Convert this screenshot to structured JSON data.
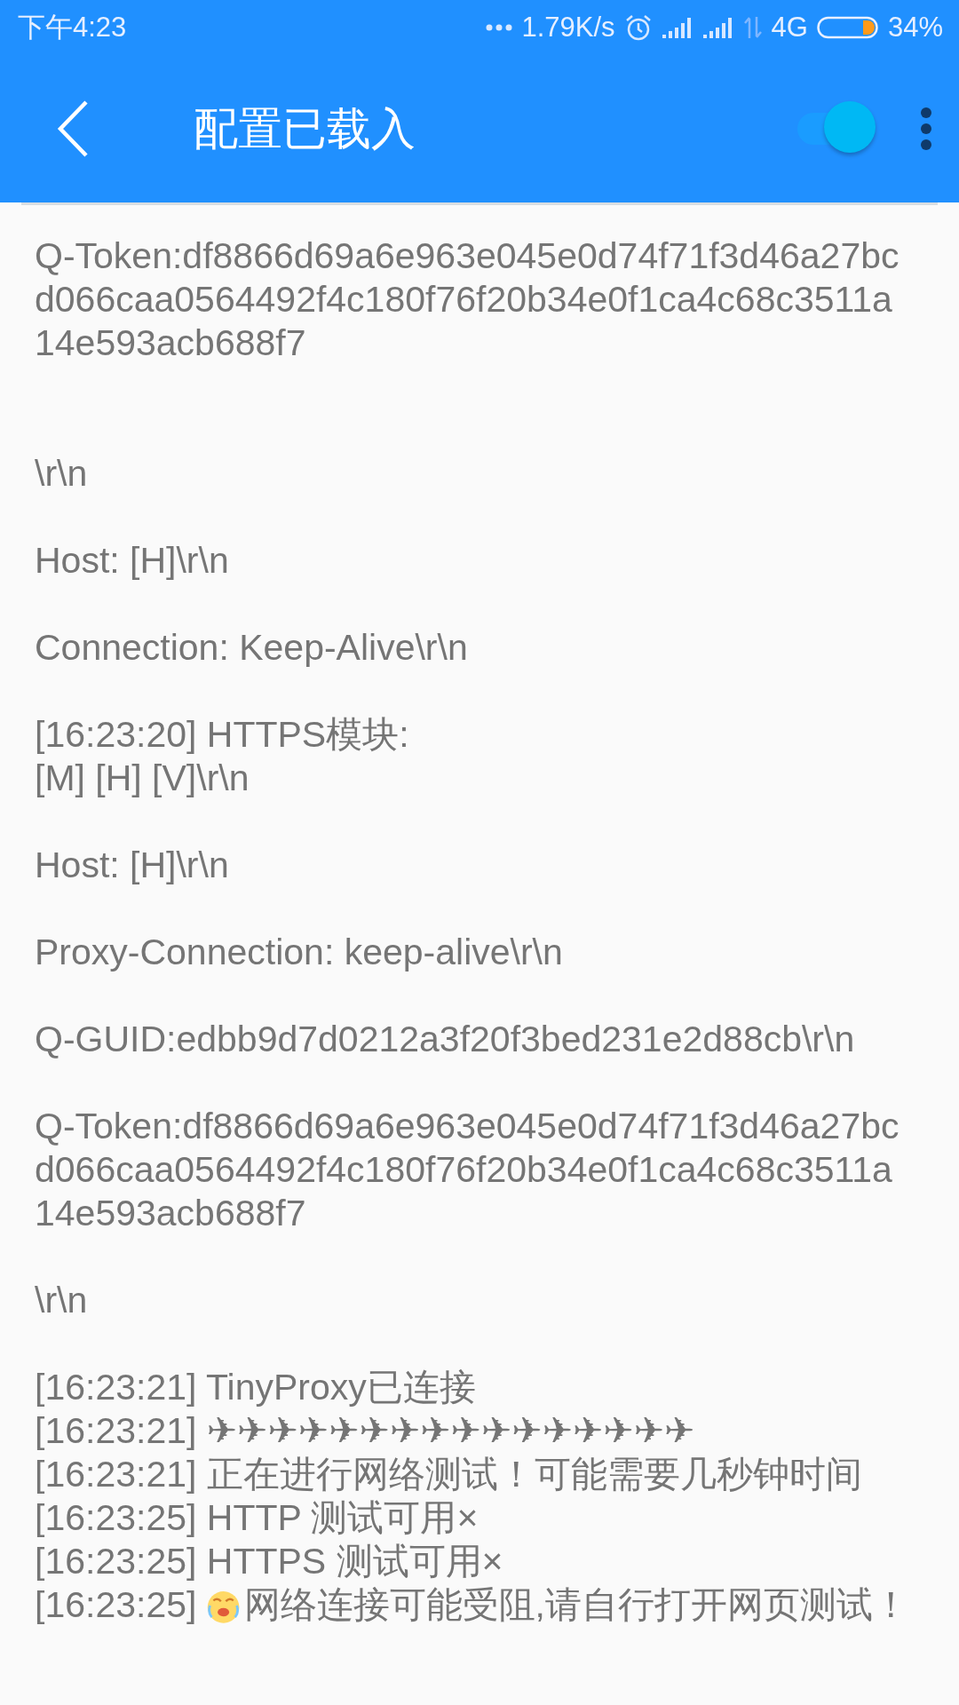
{
  "status_bar": {
    "time": "下午4:23",
    "speed": "1.79K/s",
    "network": "4G",
    "battery": "34%"
  },
  "app_bar": {
    "title": "配置已载入",
    "toggle": {
      "on": true
    }
  },
  "log": [
    {
      "kind": "text",
      "text": "Q-Token:df8866d69a6e963e045e0d74f71f3d46a27bcd066caa0564492f4c180f76f20b34e0f1ca4c68c3511a14e593acb688f7"
    },
    {
      "kind": "blank"
    },
    {
      "kind": "blank"
    },
    {
      "kind": "text",
      "text": "\\r\\n"
    },
    {
      "kind": "blank"
    },
    {
      "kind": "text",
      "text": "Host: [H]\\r\\n"
    },
    {
      "kind": "blank"
    },
    {
      "kind": "text",
      "text": "Connection: Keep-Alive\\r\\n"
    },
    {
      "kind": "blank"
    },
    {
      "kind": "text",
      "text": "[16:23:20] HTTPS模块:"
    },
    {
      "kind": "text",
      "text": "[M] [H] [V]\\r\\n"
    },
    {
      "kind": "blank"
    },
    {
      "kind": "text",
      "text": "Host: [H]\\r\\n"
    },
    {
      "kind": "blank"
    },
    {
      "kind": "text",
      "text": "Proxy-Connection: keep-alive\\r\\n"
    },
    {
      "kind": "blank"
    },
    {
      "kind": "text",
      "text": "Q-GUID:edbb9d7d0212a3f20f3bed231e2d88cb\\r\\n"
    },
    {
      "kind": "blank"
    },
    {
      "kind": "text",
      "text": "Q-Token:df8866d69a6e963e045e0d74f71f3d46a27bcd066caa0564492f4c180f76f20b34e0f1ca4c68c3511a14e593acb688f7"
    },
    {
      "kind": "blank"
    },
    {
      "kind": "text",
      "text": "\\r\\n"
    },
    {
      "kind": "blank"
    },
    {
      "kind": "text",
      "text": "[16:23:21] TinyProxy已连接"
    },
    {
      "kind": "text",
      "text": "[16:23:21] ✈✈✈✈✈✈✈✈✈✈✈✈✈✈✈✈"
    },
    {
      "kind": "text",
      "text": "[16:23:21] 正在进行网络测试！可能需要几秒钟时间"
    },
    {
      "kind": "text",
      "text": "[16:23:25] HTTP 测试可用×"
    },
    {
      "kind": "text",
      "text": "[16:23:25] HTTPS 测试可用×"
    },
    {
      "kind": "emoji_text",
      "prefix": "[16:23:25]",
      "text": "网络连接可能受阻,请自行打开网页测试！"
    }
  ]
}
